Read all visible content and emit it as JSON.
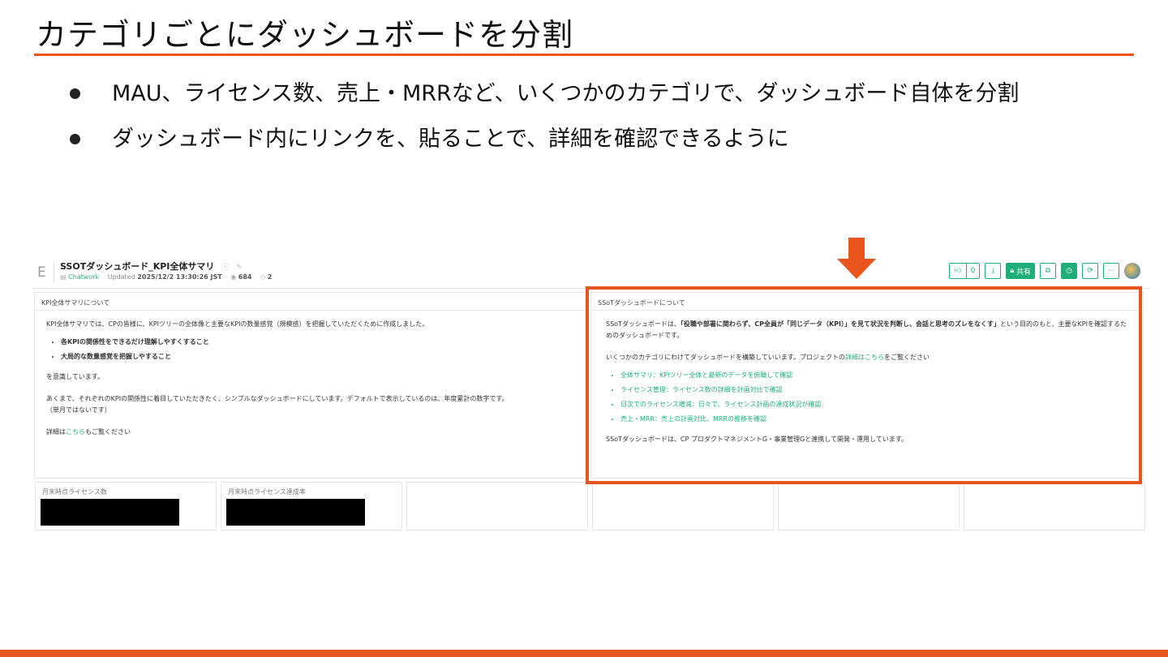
{
  "slide": {
    "title": "カテゴリごとにダッシュボードを分割",
    "bullets": [
      "MAU、ライセンス数、売上・MRRなど、いくつかのカテゴリで、ダッシュボード自体を分割",
      "ダッシュボード内にリンクを、貼ることで、詳細を確認できるように"
    ],
    "accent_color": "#e8561e"
  },
  "dashboard": {
    "logo_letter": "E",
    "name": "SSOTダッシュボード_KPI全体サマリ",
    "owner": "Chatwork",
    "updated_label": "Updated",
    "updated_value": "2025/12/2 13:30:26 JST",
    "views": "684",
    "tags": "2",
    "toolbar": {
      "like_count": "0",
      "share_label": "共有"
    },
    "left_panel": {
      "title": "KPI全体サマリについて",
      "intro": "KPI全体サマリでは、CPの皆様に、KPIツリーの全体像と主要なKPIの数量感覚（規模感）を把握していただくために作成しました。",
      "points": [
        "各KPIの関係性をできるだけ理解しやすくすること",
        "大局的な数量感覚を把握しやすること"
      ],
      "after_points": "を意識しています。",
      "note_line1": "あくまで、それぞれのKPIの関係性に着目していただきたく、シンプルなダッシュボードにしています。デフォルトで表示しているのは、年度累計の数字です。",
      "note_line2": "（単月ではないです）",
      "detail_prefix": "詳細は",
      "detail_link": "こちら",
      "detail_suffix": "もご覧ください"
    },
    "right_panel": {
      "title": "SSoTダッシュボードについて",
      "intro_prefix": "SSoTダッシュボードは、",
      "intro_bold": "「役職や部署に関わらず、CP全員が「同じデータ（KPI）」を見て状況を判断し、会話と思考のズレをなくす」",
      "intro_suffix": "という目的のもと、主要なKPIを確認するためのダッシュボードです。",
      "category_prefix": "いくつかのカテゴリにわけてダッシュボードを構築していいます。プロジェクトの",
      "category_link": "詳細はこちら",
      "category_suffix": "をご覧ください",
      "links": [
        "全体サマリ：KPIツリー全体と最新のデータを俯瞰して確認",
        "ライセンス管理：ライセンス数の詳細を計画対比で確認",
        "日次でのライセンス増減：日々で、ライセンス計画の達成状況が確認",
        "売上・MRR：売上の計画対比、MRRの推移を確認"
      ],
      "footer": "SSoTダッシュボードは、CP プロダクトマネジメントG・事業管理Gと連携して開発・運用しています。"
    },
    "metrics": [
      {
        "label": "月末時点ライセンス数"
      },
      {
        "label": "月末時点ライセンス達成率"
      }
    ]
  }
}
